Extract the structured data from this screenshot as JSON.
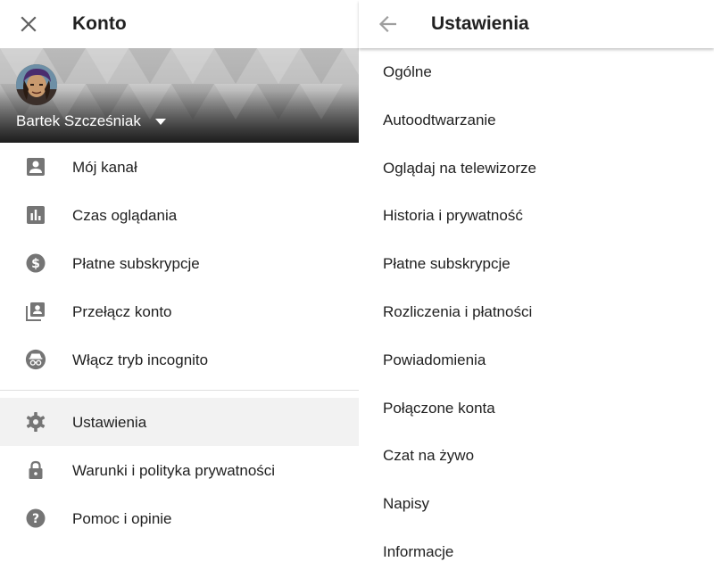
{
  "left_panel": {
    "title": "Konto",
    "account": {
      "name": "Bartek Szcześniak"
    },
    "menu": [
      {
        "label": "Mój kanał",
        "icon": "account-box-icon"
      },
      {
        "label": "Czas oglądania",
        "icon": "bar-chart-icon"
      },
      {
        "label": "Płatne subskrypcje",
        "icon": "paid-dollar-icon"
      },
      {
        "label": "Przełącz konto",
        "icon": "switch-account-icon"
      },
      {
        "label": "Włącz tryb incognito",
        "icon": "incognito-icon"
      }
    ],
    "menu_secondary": [
      {
        "label": "Ustawienia",
        "icon": "gear-icon",
        "selected": true
      },
      {
        "label": "Warunki i polityka prywatności",
        "icon": "lock-icon"
      },
      {
        "label": "Pomoc i opinie",
        "icon": "help-icon"
      }
    ]
  },
  "right_panel": {
    "title": "Ustawienia",
    "items": [
      "Ogólne",
      "Autoodtwarzanie",
      "Oglądaj na telewizorze",
      "Historia i prywatność",
      "Płatne subskrypcje",
      "Rozliczenia i płatności",
      "Powiadomienia",
      "Połączone konta",
      "Czat na żywo",
      "Napisy",
      "Informacje"
    ]
  },
  "colors": {
    "text": "#212121",
    "icon": "#757575",
    "selected_bg": "#f2f2f2",
    "divider": "#e0e0e0"
  }
}
